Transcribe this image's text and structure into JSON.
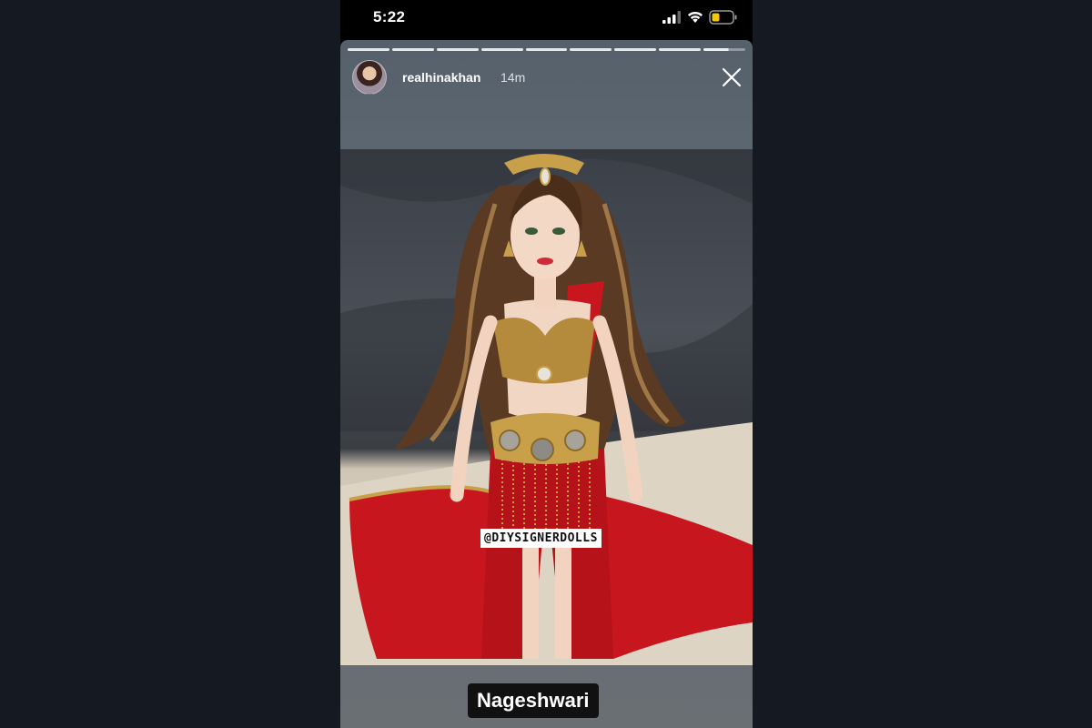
{
  "status_bar": {
    "time": "5:22",
    "signal_icon": "cellular-signal-icon",
    "wifi_icon": "wifi-icon",
    "battery_icon": "battery-low-icon",
    "battery_color": "#f5c800"
  },
  "story": {
    "progress_segments": 9,
    "username": "realhinakhan",
    "time_ago": "14m",
    "close_icon": "close-icon",
    "photo_watermark": "@DIYSIGNERDOLLS",
    "caption": "Nageshwari"
  }
}
